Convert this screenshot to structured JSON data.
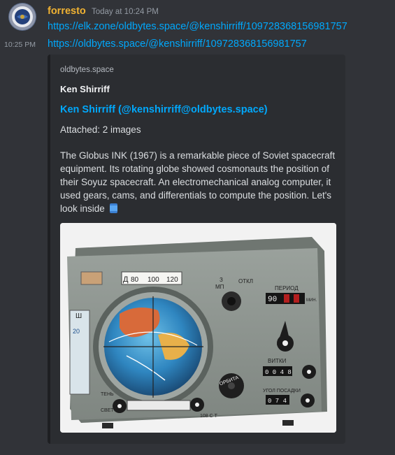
{
  "message": {
    "username": "forresto",
    "timestamp": "Today at 10:24 PM",
    "link1": "https://elk.zone/oldbytes.space/@kenshirriff/109728368156981757",
    "second_timestamp": "10:25 PM",
    "link2": "https://oldbytes.space/@kenshirriff/109728368156981757"
  },
  "embed": {
    "provider": "oldbytes.space",
    "author": "Ken Shirriff",
    "title": "Ken Shirriff (@kenshirriff@oldbytes.space)",
    "attached": "Attached: 2 images",
    "description": "The Globus INK (1967) is a remarkable piece of Soviet spacecraft equipment. Its rotating globe showed cosmonauts the position of their Soyuz spacecraft. An electromechanical analog computer, it used gears, cams, and differentials to compute the position. Let's look inside",
    "image_labels": {
      "period": "ПЕРИОД",
      "period_value": "90",
      "turns": "ВИТКИ",
      "turns_value": "0 0 4 8",
      "landing_angle": "УГОЛ ПОСАДКИ",
      "landing_value": "0 7 4",
      "orbit": "ОРБИТА",
      "shadow": "ТЕНЬ",
      "light": "СВЕТ",
      "scale_left": "80",
      "scale_mid": "100",
      "scale_right": "120",
      "mp": "МП",
      "off": "ОТКЛ",
      "min": "МИН.",
      "dial_letter": "Д",
      "sh_letter": "Ш",
      "z_letter": "З",
      "scale_vertical": "20",
      "bottom_mark": "108 С Т"
    }
  },
  "colors": {
    "background": "#313338",
    "username": "#f0b232",
    "link": "#00a8fc"
  }
}
